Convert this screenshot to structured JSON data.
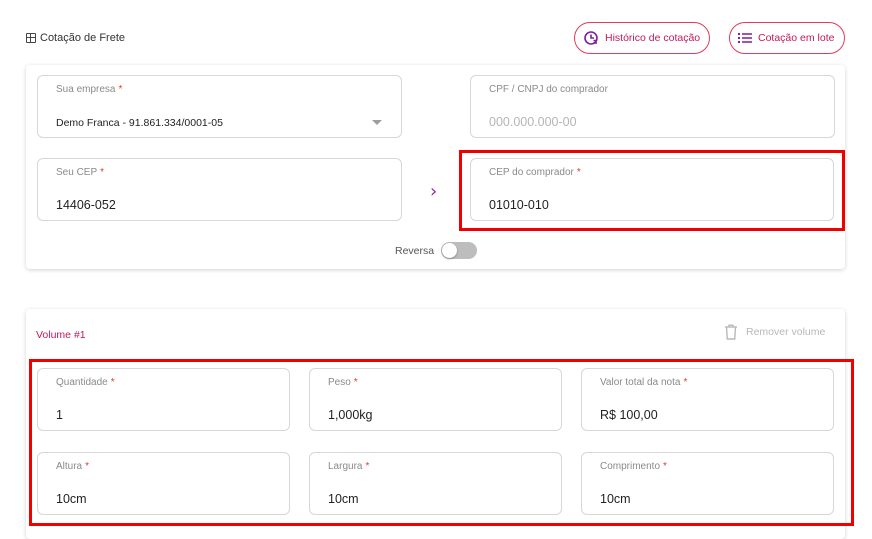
{
  "header": {
    "title": "Cotação de Frete",
    "history_button": "Histórico de cotação",
    "batch_button": "Cotação em lote"
  },
  "origin": {
    "company_label": "Sua empresa",
    "company_value": "Demo Franca - 91.861.334/0001-05",
    "cep_label": "Seu CEP",
    "cep_value": "14406-052"
  },
  "destination": {
    "doc_label": "CPF / CNPJ do comprador",
    "doc_placeholder": "000.000.000-00",
    "cep_label": "CEP do comprador",
    "cep_value": "01010-010"
  },
  "reverse": {
    "label": "Reversa",
    "enabled": false
  },
  "volume": {
    "title": "Volume #1",
    "remove_label": "Remover volume",
    "quantity_label": "Quantidade",
    "quantity_value": "1",
    "weight_label": "Peso",
    "weight_value": "1,000kg",
    "invoice_label": "Valor total da nota",
    "invoice_value": "R$ 100,00",
    "height_label": "Altura",
    "height_value": "10cm",
    "width_label": "Largura",
    "width_value": "10cm",
    "length_label": "Comprimento",
    "length_value": "10cm"
  },
  "required_mark": "*",
  "colors": {
    "accent": "#c2185b",
    "button_border": "#e23b5a",
    "highlight": "#f20000",
    "arrow": "#a0209b",
    "required": "#e53935"
  },
  "icons": {
    "title": "table-icon",
    "history": "history-clock-icon",
    "batch": "list-icon",
    "arrow": "chevron-right-icon",
    "remove": "trash-icon",
    "select": "caret-down-icon"
  }
}
